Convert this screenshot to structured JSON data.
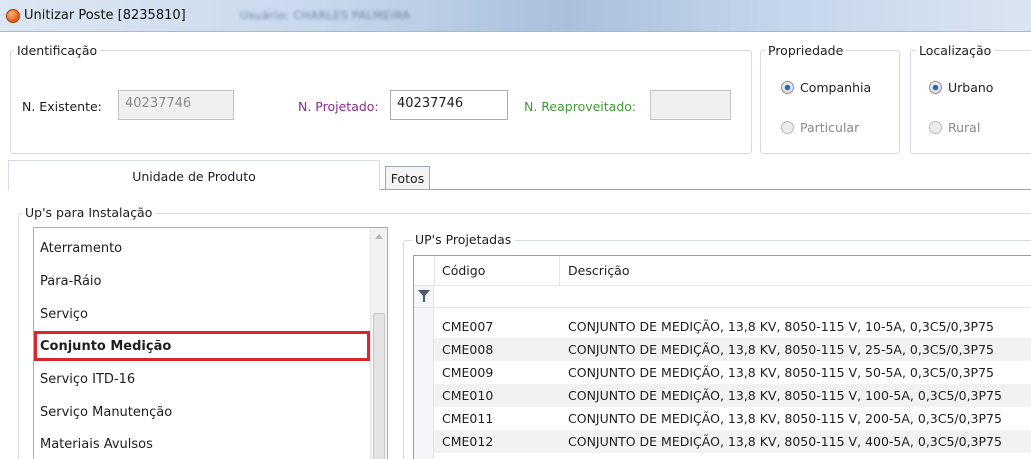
{
  "window": {
    "title": "Unitizar Poste [8235810]",
    "title_suffix_blurred": "Usuário: CHARLES PALMEIRA"
  },
  "identificacao": {
    "legend": "Identificação",
    "existente_label": "N. Existente:",
    "existente_value": "40237746",
    "projetado_label": "N. Projetado:",
    "projetado_value": "40237746",
    "reaproveitado_label": "N. Reaproveitado:",
    "reaproveitado_value": ""
  },
  "propriedade": {
    "legend": "Propriedade",
    "options": [
      {
        "label": "Companhia",
        "checked": true
      },
      {
        "label": "Particular",
        "checked": false
      }
    ]
  },
  "localizacao": {
    "legend": "Localização",
    "options": [
      {
        "label": "Urbano",
        "checked": true
      },
      {
        "label": "Rural",
        "checked": false
      }
    ]
  },
  "tabs": [
    {
      "label": "Unidade de Produto",
      "active": true
    },
    {
      "label": "Fotos",
      "active": false
    }
  ],
  "instalacao": {
    "legend": "Up's para Instalação",
    "items": [
      {
        "label": "Aterramento",
        "selected": false
      },
      {
        "label": "Para-Ráio",
        "selected": false
      },
      {
        "label": "Serviço",
        "selected": false
      },
      {
        "label": "Conjunto Medição",
        "selected": true
      },
      {
        "label": "Serviço ITD-16",
        "selected": false
      },
      {
        "label": "Serviço Manutenção",
        "selected": false
      },
      {
        "label": "Materiais Avulsos",
        "selected": false
      }
    ]
  },
  "projetadas": {
    "legend": "UP's Projetadas",
    "columns": {
      "code": "Código",
      "desc": "Descrição"
    },
    "rows": [
      {
        "code": "CME007",
        "desc": "CONJUNTO DE MEDIÇÃO, 13,8 KV, 8050-115 V, 10-5A, 0,3C5/0,3P75"
      },
      {
        "code": "CME008",
        "desc": "CONJUNTO DE MEDIÇÃO, 13,8 KV, 8050-115 V, 25-5A, 0,3C5/0,3P75"
      },
      {
        "code": "CME009",
        "desc": "CONJUNTO DE MEDIÇÃO, 13,8 KV, 8050-115 V, 50-5A, 0,3C5/0,3P75"
      },
      {
        "code": "CME010",
        "desc": "CONJUNTO DE MEDIÇÃO, 13,8 KV, 8050-115 V, 100-5A, 0,3C5/0,3P75"
      },
      {
        "code": "CME011",
        "desc": "CONJUNTO DE MEDIÇÃO, 13,8 KV, 8050-115 V, 200-5A, 0,3C5/0,3P75"
      },
      {
        "code": "CME012",
        "desc": "CONJUNTO DE MEDIÇÃO, 13,8 KV, 8050-115 V, 400-5A, 0,3C5/0,3P75"
      }
    ]
  }
}
